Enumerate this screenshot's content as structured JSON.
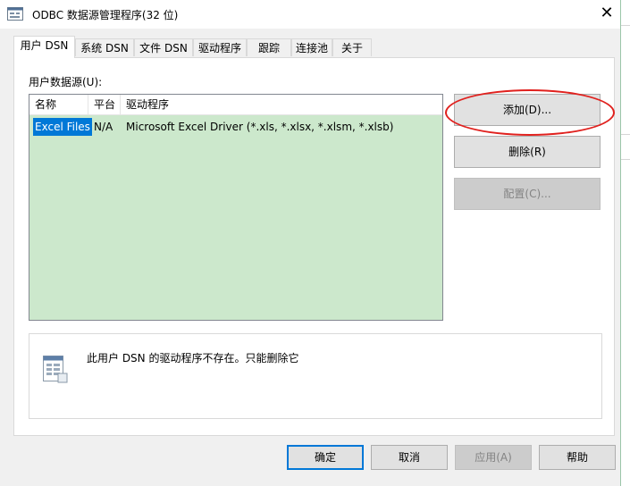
{
  "window": {
    "title": "ODBC 数据源管理程序(32 位)",
    "close_glyph": "✕"
  },
  "tabs": [
    {
      "label": "用户 DSN",
      "active": true
    },
    {
      "label": "系统 DSN"
    },
    {
      "label": "文件 DSN"
    },
    {
      "label": "驱动程序"
    },
    {
      "label": "跟踪"
    },
    {
      "label": "连接池"
    },
    {
      "label": "关于"
    }
  ],
  "user_dsn": {
    "section_label": "用户数据源(U):",
    "columns": [
      "名称",
      "平台",
      "驱动程序"
    ],
    "rows": [
      {
        "name": "Excel Files",
        "platform": "N/A",
        "driver": "Microsoft Excel Driver (*.xls, *.xlsx, *.xlsm, *.xlsb)"
      }
    ],
    "buttons": {
      "add": "添加(D)...",
      "remove": "删除(R)",
      "configure": "配置(C)..."
    },
    "info_text": "此用户 DSN 的驱动程序不存在。只能删除它"
  },
  "footer": {
    "ok": "确定",
    "cancel": "取消",
    "apply": "应用(A)",
    "help": "帮助"
  },
  "colors": {
    "list_background": "#cce8cc",
    "selection": "#0078d7",
    "highlight": "#e0211e"
  },
  "icons": {
    "window": "odbc-app-icon",
    "close": "close-icon",
    "info": "datasource-document-icon"
  }
}
